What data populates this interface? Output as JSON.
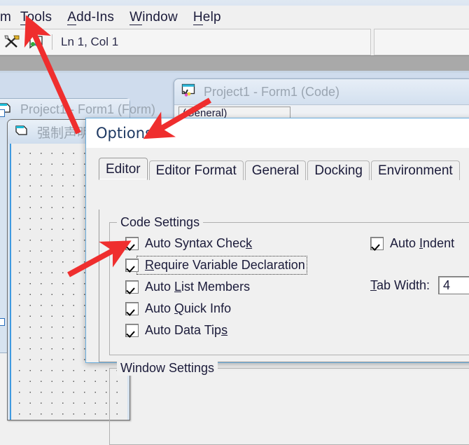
{
  "menubar": {
    "clipped_item": "m",
    "items": [
      {
        "label": "Tools",
        "mnemonic": "T"
      },
      {
        "label": "Add-Ins",
        "mnemonic": "A"
      },
      {
        "label": "Window",
        "mnemonic": "W"
      },
      {
        "label": "Help",
        "mnemonic": "H"
      }
    ]
  },
  "toolbar": {
    "tools_icon": "hammer-wrench-icon",
    "palette_icon": "color-palette-icon",
    "position_text": "Ln 1, Col 1"
  },
  "code_window": {
    "icon": "code-window-icon",
    "title": "Project1 - Form1 (Code)",
    "object_combo": "(General)"
  },
  "form_window": {
    "icon": "form-window-icon",
    "title": "Project1 - Form1 (Form)"
  },
  "form_designer": {
    "icon": "form-icon",
    "title": "强制声明"
  },
  "dialog": {
    "title": "Options",
    "tabs": [
      {
        "label": "Editor",
        "active": true
      },
      {
        "label": "Editor Format",
        "active": false
      },
      {
        "label": "General",
        "active": false
      },
      {
        "label": "Docking",
        "active": false
      },
      {
        "label": "Environment",
        "active": false
      }
    ],
    "code_settings": {
      "legend": "Code Settings",
      "left_checkboxes": [
        {
          "label": "Auto Syntax Check",
          "mnemonic": "k",
          "checked": true,
          "focused": false
        },
        {
          "label": "Require Variable Declaration",
          "mnemonic": "R",
          "checked": true,
          "focused": true
        },
        {
          "label": "Auto List Members",
          "mnemonic": "L",
          "checked": true,
          "focused": false
        },
        {
          "label": "Auto Quick Info",
          "mnemonic": "Q",
          "checked": true,
          "focused": false
        },
        {
          "label": "Auto Data Tips",
          "mnemonic": "s",
          "checked": true,
          "focused": false
        }
      ],
      "right_checkboxes": [
        {
          "label": "Auto Indent",
          "mnemonic": "I",
          "checked": true,
          "focused": false
        }
      ],
      "tab_width_label": "Tab Width:",
      "tab_width_value": "4"
    },
    "window_settings": {
      "legend": "Window Settings"
    }
  },
  "annotations": {
    "arrow_color": "#ef2e2e",
    "arrows": [
      {
        "name": "arrow-to-tools-menu",
        "from": [
          112,
          190
        ],
        "to": [
          43,
          38
        ]
      },
      {
        "name": "arrow-to-options-title",
        "from": [
          300,
          143
        ],
        "to": [
          219,
          190
        ]
      },
      {
        "name": "arrow-to-require-variable-declaration",
        "from": [
          98,
          392
        ],
        "to": [
          172,
          352
        ]
      }
    ]
  }
}
